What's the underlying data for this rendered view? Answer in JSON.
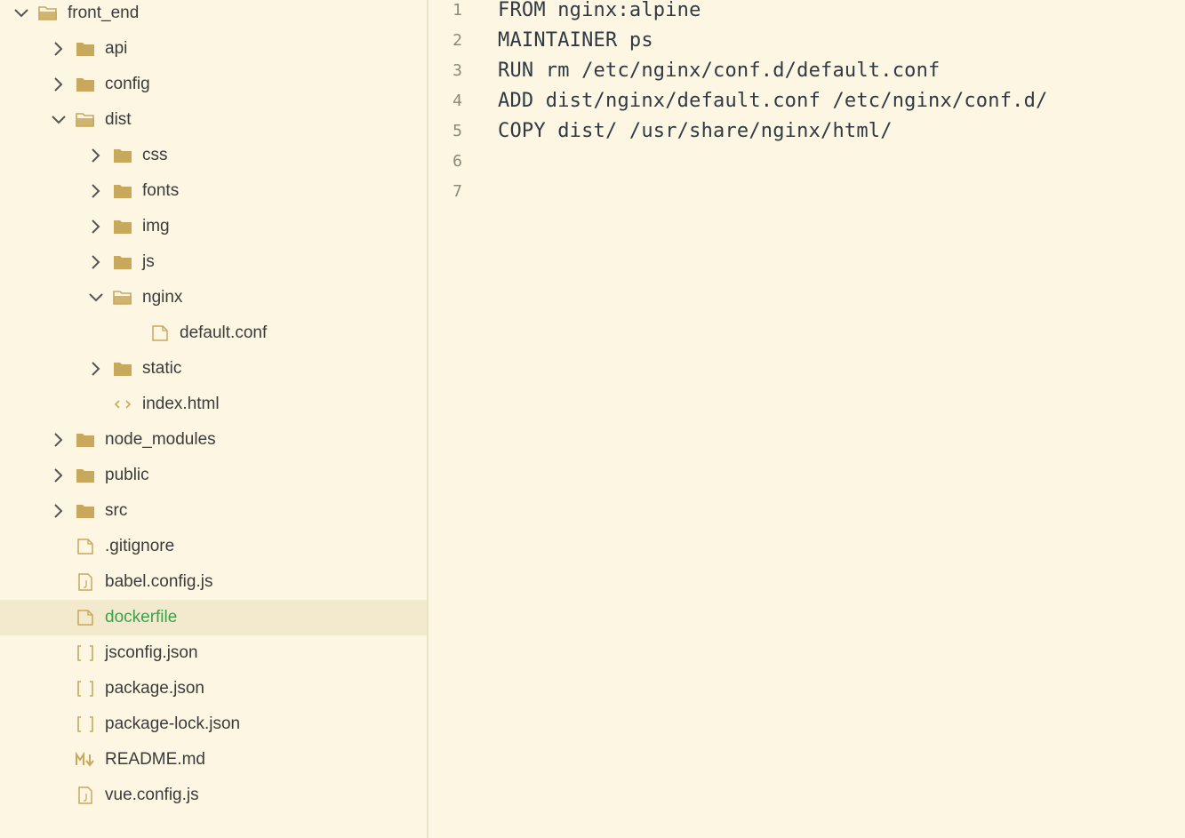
{
  "sidebar": {
    "items": [
      {
        "label": "front_end",
        "depth": 0,
        "kind": "folder",
        "expanded": true
      },
      {
        "label": "api",
        "depth": 1,
        "kind": "folder",
        "expanded": false
      },
      {
        "label": "config",
        "depth": 1,
        "kind": "folder",
        "expanded": false
      },
      {
        "label": "dist",
        "depth": 1,
        "kind": "folder",
        "expanded": true
      },
      {
        "label": "css",
        "depth": 2,
        "kind": "folder",
        "expanded": false
      },
      {
        "label": "fonts",
        "depth": 2,
        "kind": "folder",
        "expanded": false
      },
      {
        "label": "img",
        "depth": 2,
        "kind": "folder",
        "expanded": false
      },
      {
        "label": "js",
        "depth": 2,
        "kind": "folder",
        "expanded": false
      },
      {
        "label": "nginx",
        "depth": 2,
        "kind": "folder",
        "expanded": true
      },
      {
        "label": "default.conf",
        "depth": 3,
        "kind": "file"
      },
      {
        "label": "static",
        "depth": 2,
        "kind": "folder",
        "expanded": false
      },
      {
        "label": "index.html",
        "depth": 2,
        "kind": "html"
      },
      {
        "label": "node_modules",
        "depth": 1,
        "kind": "folder",
        "expanded": false
      },
      {
        "label": "public",
        "depth": 1,
        "kind": "folder",
        "expanded": false
      },
      {
        "label": "src",
        "depth": 1,
        "kind": "folder",
        "expanded": false
      },
      {
        "label": ".gitignore",
        "depth": 1,
        "kind": "file"
      },
      {
        "label": "babel.config.js",
        "depth": 1,
        "kind": "js"
      },
      {
        "label": "dockerfile",
        "depth": 1,
        "kind": "file",
        "selected": true
      },
      {
        "label": "jsconfig.json",
        "depth": 1,
        "kind": "json"
      },
      {
        "label": "package.json",
        "depth": 1,
        "kind": "json"
      },
      {
        "label": "package-lock.json",
        "depth": 1,
        "kind": "json"
      },
      {
        "label": "README.md",
        "depth": 1,
        "kind": "md"
      },
      {
        "label": "vue.config.js",
        "depth": 1,
        "kind": "js"
      }
    ]
  },
  "editor": {
    "lines": [
      {
        "num": "1",
        "text": "FROM nginx:alpine"
      },
      {
        "num": "2",
        "text": "MAINTAINER ps"
      },
      {
        "num": "3",
        "text": "RUN rm /etc/nginx/conf.d/default.conf"
      },
      {
        "num": "4",
        "text": "ADD dist/nginx/default.conf /etc/nginx/conf.d/"
      },
      {
        "num": "5",
        "text": "COPY dist/ /usr/share/nginx/html/"
      },
      {
        "num": "6",
        "text": ""
      },
      {
        "num": "7",
        "text": ""
      }
    ]
  },
  "colors": {
    "background": "#fdf6e3",
    "selected_row": "#f3e9cd",
    "selected_text": "#3ea04a",
    "folder_icon": "#c8a85a",
    "chevron": "#555555"
  }
}
